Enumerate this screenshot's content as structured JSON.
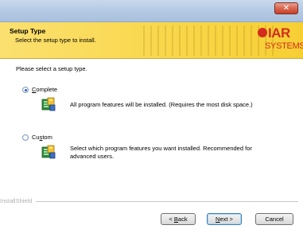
{
  "window": {
    "close_glyph": "✕"
  },
  "header": {
    "title": "Setup Type",
    "subtitle": "Select the setup type to install.",
    "logo": {
      "brand": "IAR",
      "tagline": "SYSTEMS",
      "color": "#d52b1e"
    }
  },
  "body": {
    "prompt": "Please select a setup type.",
    "options": [
      {
        "label_prefix": "",
        "label_hotkey": "C",
        "label_suffix": "omplete",
        "selected": true,
        "icon": "setup-package-icon",
        "description": "All program features will be installed. (Requires the most disk space.)"
      },
      {
        "label_prefix": "Cu",
        "label_hotkey": "s",
        "label_suffix": "tom",
        "selected": false,
        "icon": "setup-package-icon",
        "description": "Select which program features you want installed. Recommended for advanced users."
      }
    ]
  },
  "footer": {
    "brand": "InstallShield",
    "buttons": {
      "back": {
        "prefix": "< ",
        "hotkey": "B",
        "suffix": "ack"
      },
      "next": {
        "prefix": "",
        "hotkey": "N",
        "suffix": "ext >"
      },
      "cancel": "Cancel"
    }
  }
}
